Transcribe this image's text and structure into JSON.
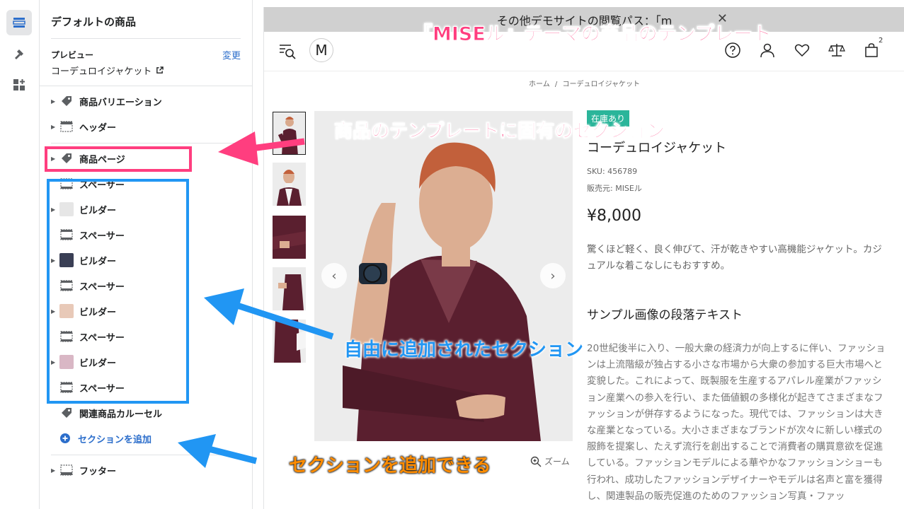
{
  "editor": {
    "panel_title": "デフォルトの商品",
    "preview_label": "プレビュー",
    "change_link": "変更",
    "preview_value": "コーデュロイジャケット",
    "sections": [
      {
        "label": "商品バリエーション",
        "icon": "tag-icon",
        "caret": true
      },
      {
        "label": "ヘッダー",
        "icon": "header-layout-icon",
        "caret": true
      },
      {
        "label": "商品ページ",
        "icon": "tag-icon",
        "caret": true
      },
      {
        "label": "スペーサー",
        "icon": "spacer-icon",
        "caret": false
      },
      {
        "label": "ビルダー",
        "icon": "thumbnail",
        "caret": true
      },
      {
        "label": "スペーサー",
        "icon": "spacer-icon",
        "caret": false
      },
      {
        "label": "ビルダー",
        "icon": "thumbnail",
        "caret": true
      },
      {
        "label": "スペーサー",
        "icon": "spacer-icon",
        "caret": false
      },
      {
        "label": "ビルダー",
        "icon": "thumbnail",
        "caret": true
      },
      {
        "label": "スペーサー",
        "icon": "spacer-icon",
        "caret": false
      },
      {
        "label": "ビルダー",
        "icon": "thumbnail",
        "caret": true
      },
      {
        "label": "スペーサー",
        "icon": "spacer-icon",
        "caret": false
      },
      {
        "label": "関連商品カルーセル",
        "icon": "tag-icon",
        "caret": false
      }
    ],
    "add_section": "セクションを追加",
    "footer": "フッター"
  },
  "store": {
    "notice": "その他デモサイトの閲覧パス：「m",
    "logo": "M",
    "cart_count": "2",
    "breadcrumb_home": "ホーム",
    "breadcrumb_sep": "/",
    "breadcrumb_current": "コーデュロイジャケット",
    "stock_badge": "在庫あり",
    "product_title": "コーデュロイジャケット",
    "sku": "SKU: 456789",
    "vendor": "販売元: MISEル",
    "price": "¥8,000",
    "description": "驚くほど軽く、良く伸びて、汗が乾きやすい高機能ジャケット。カジュアルな着こなしにもおすすめ。",
    "subheading": "サンプル画像の段落テキスト",
    "paragraph": "20世紀後半に入り、一般大衆の経済力が向上するに伴い、ファッションは上流階級が独占する小さな市場から大衆の参加する巨大市場へと変貌した。これによって、既製服を生産するアパレル産業がファッション産業への参入を行い、また価値観の多様化が起きてさまざまなファッションが併存するようになった。現代では、ファッションは大きな産業となっている。大小さまざまなブランドが次々に新しい様式の服飾を提案し、たえず流行を創出することで消費者の購買意欲を促進している。ファッションモデルによる華やかなファッションショーも行われ、成功したファッションデザイナーやモデルは名声と富を獲得し、関連製品の販売促進のためのファッション写真・ファッ",
    "zoom": "ズーム"
  },
  "annotations": {
    "title": "『MISEル』テーマの商品のテンプレート",
    "template_section": "商品のテンプレートに固有のセクション",
    "free_sections": "自由に追加されたセクション",
    "add_sections": "セクションを追加できる"
  },
  "colors": {
    "pink": "#ff3e7f",
    "blue": "#2196f3",
    "orange": "#ff8c00",
    "link": "#2c6ecb",
    "stock": "#2bb59a"
  }
}
